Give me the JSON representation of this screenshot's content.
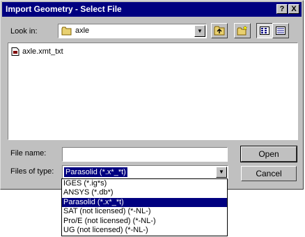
{
  "window": {
    "title": "Import Geometry - Select File",
    "help_label": "?",
    "close_label": "X"
  },
  "look_in": {
    "label": "Look in:",
    "folder": "axle",
    "folder_icon": "folder-icon"
  },
  "toolbar": {
    "buttons": [
      {
        "name": "up-one-level-button",
        "icon": "up-folder-icon"
      },
      {
        "name": "create-new-folder-button",
        "icon": "new-folder-icon"
      },
      {
        "name": "list-view-button",
        "icon": "list-view-icon",
        "pressed": true
      },
      {
        "name": "details-view-button",
        "icon": "details-view-icon"
      }
    ]
  },
  "files": [
    {
      "name": "axle.xmt_txt",
      "icon": "document-icon"
    }
  ],
  "file_name": {
    "label": "File name:",
    "value": ""
  },
  "file_type": {
    "label": "Files of type:",
    "selected": "Parasolid (*.x*_*t)",
    "options": [
      "IGES (*.ig*s)",
      "ANSYS (*.db*)",
      "Parasolid (*.x*_*t)",
      "SAT (not licensed) (*-NL-)",
      "Pro/E (not licensed) (*-NL-)",
      "UG (not licensed) (*-NL-)"
    ],
    "selected_index": 2
  },
  "buttons": {
    "open": "Open",
    "cancel": "Cancel"
  },
  "colors": {
    "titlebar": "#000080",
    "face": "#c0c0c0",
    "highlight": "#000080"
  }
}
